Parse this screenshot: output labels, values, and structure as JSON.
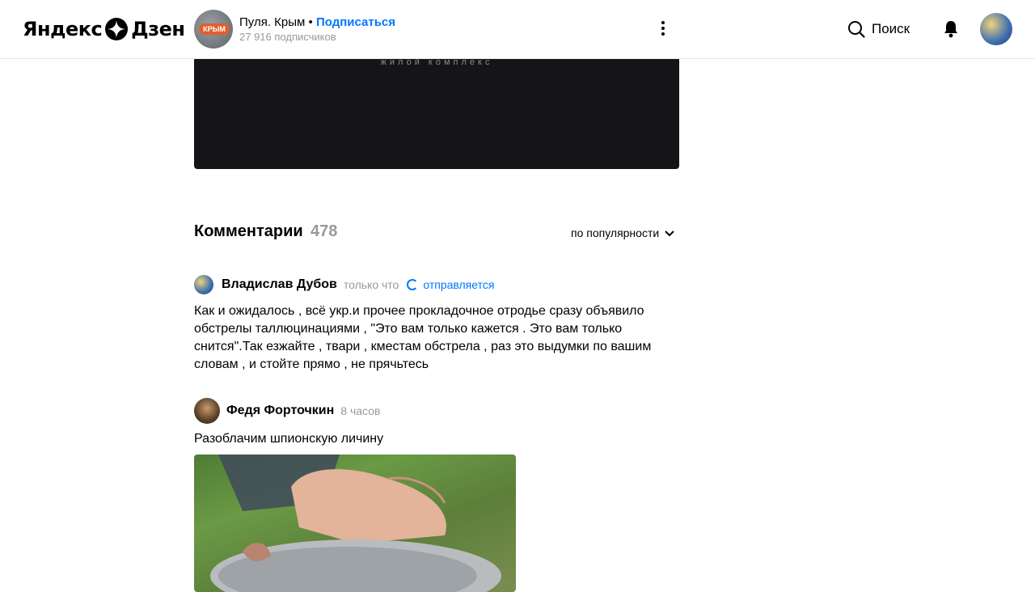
{
  "header": {
    "logo": {
      "left": "Яндекс",
      "right": "Дзен"
    },
    "channel": {
      "name": "Пуля. Крым",
      "separator": "•",
      "subscribe_label": "Подписаться",
      "subscribers": "27 916 подписчиков",
      "avatar_badge": "КРЫМ"
    },
    "search_label": "Поиск",
    "icons": [
      "more-icon",
      "search-icon",
      "bell-icon",
      "user-avatar"
    ]
  },
  "video": {
    "caption": "жилой комплекс"
  },
  "comments": {
    "title": "Комментарии",
    "count": "478",
    "sort_label": "по популярности",
    "items": [
      {
        "author": "Владислав Дубов",
        "time": "только что",
        "status": "отправляется",
        "text": "Как и ожидалось , всё укр.и прочее прокладочное отродье сразу объявило обстрелы таллюцинациями , \"Это вам только кажется . Это вам только снится\".Так езжайте , твари , кместам обстрела , раз это выдумки по вашим словам , и стойте прямо , не прячьтесь"
      },
      {
        "author": "Федя Форточкин",
        "time": "8 часов",
        "text": "Разоблачим шпионскую личину"
      }
    ]
  },
  "colors": {
    "accent": "#0077ff",
    "muted": "#999999",
    "video_bg": "#151518"
  }
}
